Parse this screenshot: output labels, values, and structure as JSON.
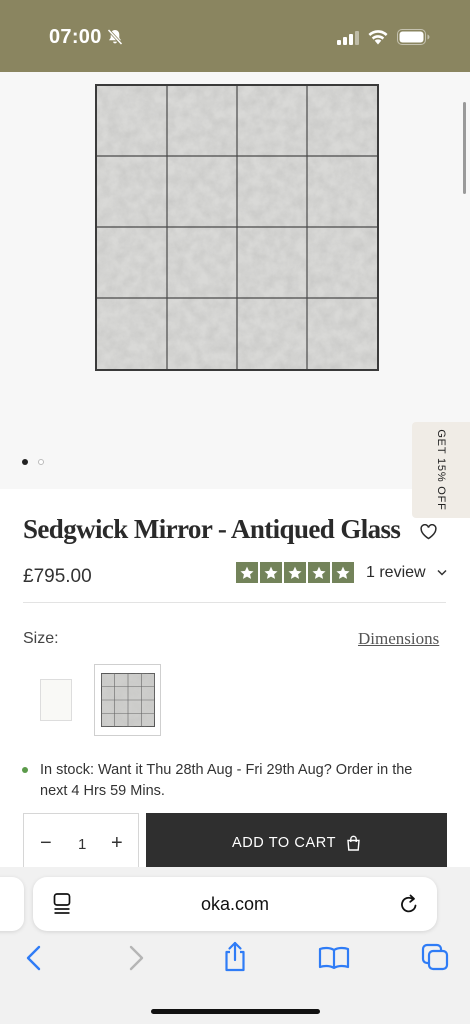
{
  "status_bar": {
    "time": "07:00",
    "icons": [
      "bell-slash-icon",
      "signal-icon",
      "wifi-icon",
      "battery-icon"
    ]
  },
  "gallery": {
    "image": "mirror-product-image",
    "slide_count": 2,
    "active_slide": 1
  },
  "promo": {
    "label": "GET 15% OFF"
  },
  "product": {
    "title": "Sedgwick Mirror - Antiqued Glass",
    "price": "£795.00",
    "rating": 5,
    "review_label": "1 review"
  },
  "options": {
    "size_label": "Size:",
    "dimensions_link": "Dimensions"
  },
  "stock": {
    "message": "In stock: Want it Thu 28th Aug - Fri 29th Aug? Order in the next 4 Hrs 59 Mins."
  },
  "cart": {
    "quantity": "1",
    "minus": "−",
    "plus": "+",
    "add_label": "ADD TO CART"
  },
  "browser": {
    "url": "oka.com",
    "toolbar": [
      "back-icon",
      "forward-icon",
      "share-icon",
      "bookmarks-icon",
      "tabs-icon"
    ]
  },
  "colors": {
    "status_bar_bg": "#8a8560",
    "star_green": "#73835a",
    "button_dark": "#2f2f2f",
    "safari_blue": "#2f7cf6",
    "stock_green": "#5b9a4a"
  }
}
